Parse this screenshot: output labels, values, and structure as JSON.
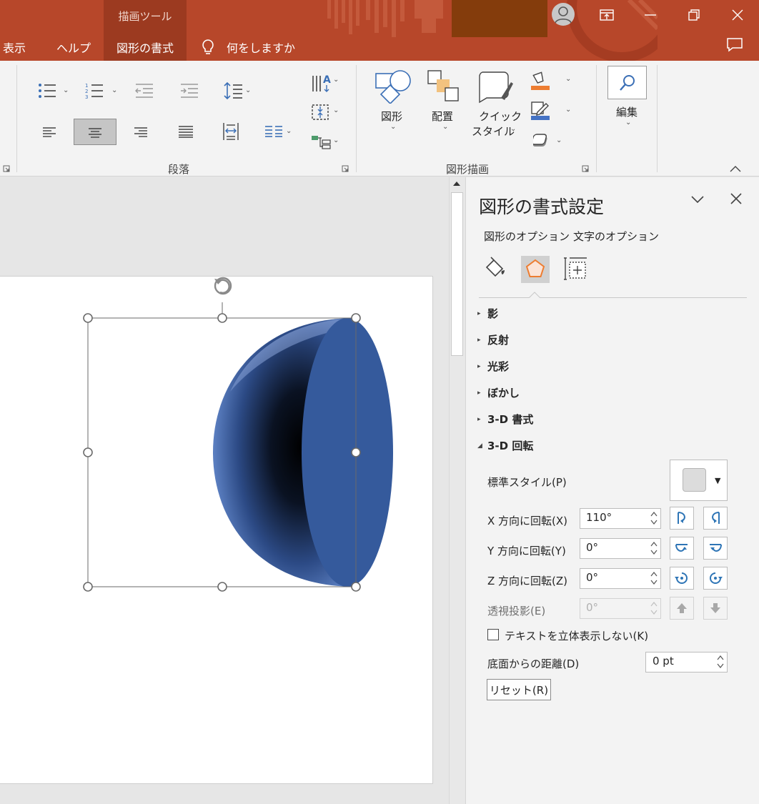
{
  "titlebar": {
    "context_tab_group": "描画ツール",
    "tabs": {
      "view": "表示",
      "help": "ヘルプ",
      "shape_format": "図形の書式"
    },
    "tell_me": "何をしますか"
  },
  "ribbon": {
    "groups": {
      "paragraph": "段落",
      "drawing": "図形描画"
    },
    "buttons": {
      "shapes": "図形",
      "arrange": "配置",
      "quick_styles_line1": "クイック",
      "quick_styles_line2": "スタイル",
      "editing": "編集"
    },
    "colors": {
      "fill_accent": "#ed7d31",
      "line_accent": "#4472c4"
    }
  },
  "pane": {
    "title": "図形の書式設定",
    "tabs": {
      "shape_options": "図形のオプション",
      "text_options": "文字のオプション"
    },
    "icons": [
      "fill-line-icon",
      "effects-icon",
      "size-properties-icon"
    ],
    "sections": {
      "shadow": "影",
      "reflection": "反射",
      "glow": "光彩",
      "soft_edges": "ぼかし",
      "format_3d": "3-D 書式",
      "rotation_3d": "3-D 回転"
    },
    "rotation": {
      "preset_label": "標準スタイル(P)",
      "x_label": "X 方向に回転(X)",
      "x_value": "110°",
      "y_label": "Y 方向に回転(Y)",
      "y_value": "0°",
      "z_label": "Z 方向に回転(Z)",
      "z_value": "0°",
      "perspective_label": "透視投影(E)",
      "perspective_value": "0°",
      "keep_text_flat_label": "テキストを立体表示しない(K)",
      "keep_text_flat_checked": false,
      "distance_label": "底面からの距離(D)",
      "distance_value": "0 pt",
      "reset_label": "リセット(R)"
    }
  }
}
